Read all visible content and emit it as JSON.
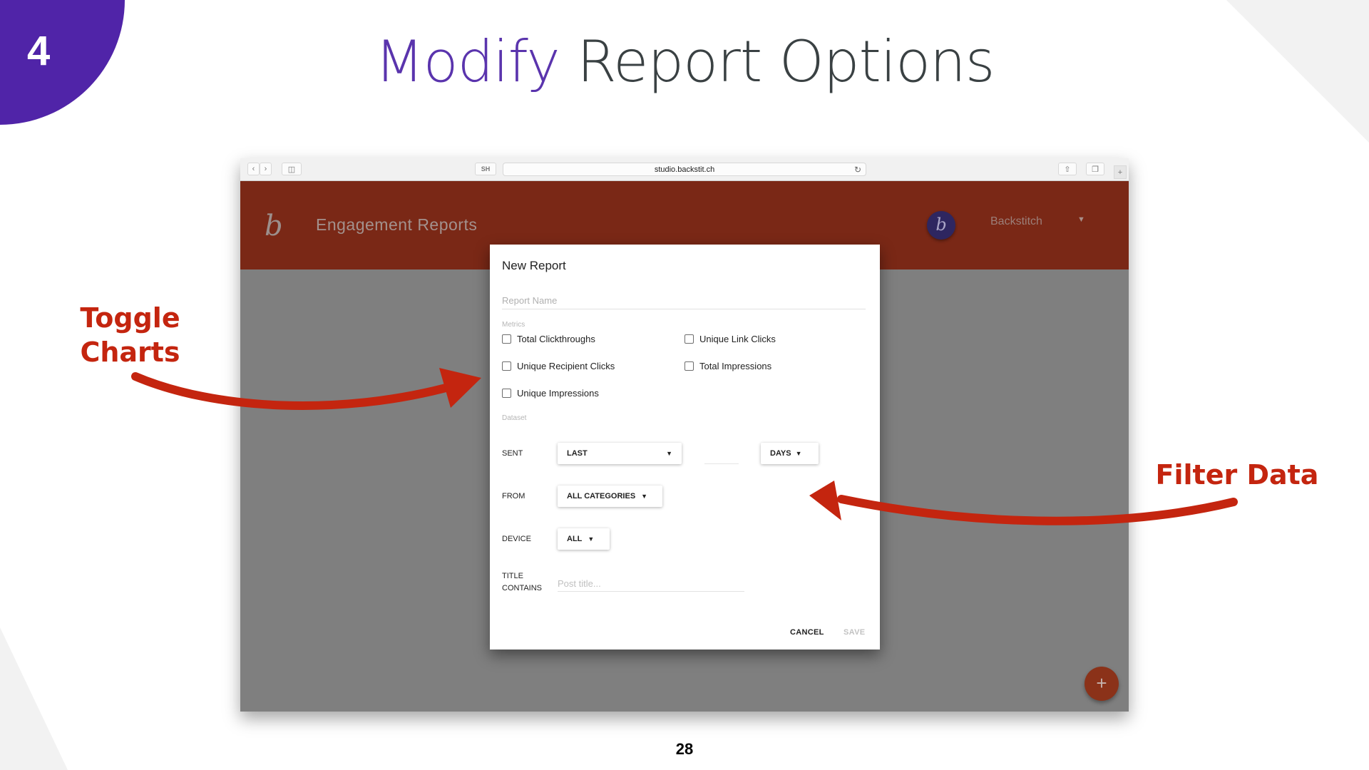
{
  "slide": {
    "step_number": "4",
    "title_accent": "Modify",
    "title_rest": " Report Options",
    "page_number": "28",
    "accent_color": "#5024a8"
  },
  "annotations": {
    "left": "Toggle Charts",
    "left_line1": "Toggle",
    "left_line2": "Charts",
    "right": "Filter Data",
    "color": "#c4250f"
  },
  "browser": {
    "url": "studio.backstit.ch",
    "sh_label": "SH",
    "back_icon": "chevron-left-icon",
    "forward_icon": "chevron-right-icon",
    "sidebar_icon": "sidebar-icon",
    "reload_icon": "reload-icon",
    "share_icon": "share-icon",
    "tabs_icon": "tabs-icon",
    "new_tab_icon": "plus-icon"
  },
  "app": {
    "title": "Engagement Reports",
    "user_name": "Backstitch",
    "avatar_letter": "b",
    "logo_glyph": "b",
    "header_color": "#7a2816",
    "fab_label": "+"
  },
  "dialog": {
    "title": "New Report",
    "report_name_placeholder": "Report Name",
    "report_name_value": "",
    "metrics_label": "Metrics",
    "metrics": [
      {
        "label": "Total Clickthroughs",
        "checked": false
      },
      {
        "label": "Unique Link Clicks",
        "checked": false
      },
      {
        "label": "Unique Recipient Clicks",
        "checked": false
      },
      {
        "label": "Total Impressions",
        "checked": false
      },
      {
        "label": "Unique Impressions",
        "checked": false
      }
    ],
    "dataset_label": "Dataset",
    "sent_label": "SENT",
    "sent_select": "LAST",
    "sent_count_value": "",
    "sent_unit_select": "DAYS",
    "from_label": "FROM",
    "from_select": "ALL CATEGORIES",
    "device_label": "DEVICE",
    "device_select": "ALL",
    "title_contains_label_1": "TITLE",
    "title_contains_label_2": "CONTAINS",
    "title_contains_placeholder": "Post title...",
    "cancel_label": "CANCEL",
    "save_label": "SAVE"
  }
}
